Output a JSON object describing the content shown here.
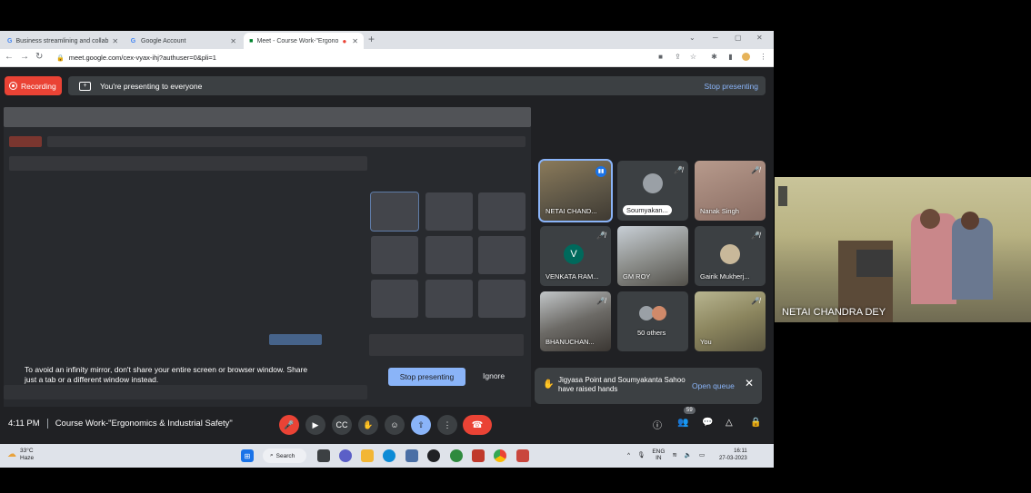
{
  "browser": {
    "tabs": [
      {
        "label": "Business streamlining and collab"
      },
      {
        "label": "Google Account"
      },
      {
        "label": "Meet - Course Work-\"Ergono"
      }
    ],
    "url": "meet.google.com/cex-vyax-ihj?authuser=0&pli=1"
  },
  "meet": {
    "recording_label": "Recording",
    "presenting_label": "You're presenting to everyone",
    "stop_presenting_top": "Stop presenting",
    "participants": [
      {
        "name": "NETAI CHAND...",
        "speaking": true
      },
      {
        "name": "Soumyakan..."
      },
      {
        "name": "Nanak Singh"
      },
      {
        "name": "VENKATA RAM...",
        "initial": "V"
      },
      {
        "name": "GM ROY"
      },
      {
        "name": "Gairik Mukherj..."
      },
      {
        "name": "BHANUCHAN..."
      },
      {
        "name": "50 others"
      },
      {
        "name": "You"
      }
    ],
    "mirror_warning": "To avoid an infinity mirror, don't share your entire screen or browser window. Share just a tab or a different window instead.",
    "stop_presenting_btn": "Stop presenting",
    "ignore_btn": "Ignore",
    "hand_notice": "Jigyasa Point and Soumyakanta Sahoo have raised hands",
    "open_queue": "Open queue",
    "time": "4:11 PM",
    "meeting_title": "Course Work-\"Ergonomics & Industrial Safety\"",
    "participant_count": "59"
  },
  "taskbar": {
    "temp": "33°C",
    "weather": "Haze",
    "search": "Search",
    "lang": "ENG",
    "region": "IN",
    "clock_time": "16:11",
    "clock_date": "27-03-2023"
  },
  "camera": {
    "name": "NETAI CHANDRA DEY"
  }
}
